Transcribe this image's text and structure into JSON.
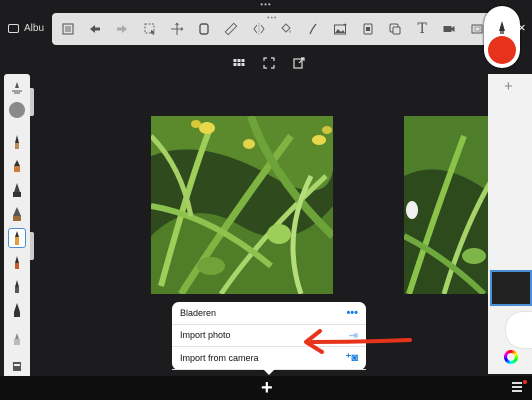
{
  "app": {
    "album_label_fragment": "Albu"
  },
  "toolbar": {
    "tools": [
      "list-icon",
      "undo-icon",
      "redo-icon",
      "select-icon",
      "transform-icon",
      "layer-icon",
      "ruler-icon",
      "symmetry-icon",
      "fill-icon",
      "stroke-icon",
      "image-icon",
      "stamp-icon",
      "perspective-icon",
      "text-icon",
      "video-icon",
      "crop-icon"
    ],
    "text_tool_glyph": "T"
  },
  "colors": {
    "accent_red": "#e8331c",
    "selection_blue": "#4a90d9",
    "menu_blue": "#1a7fe0"
  },
  "brushes": [
    "brush-1",
    "brush-2",
    "brush-3",
    "brush-4",
    "brush-5",
    "brush-6",
    "brush-7",
    "brush-8",
    "brush-9",
    "brush-10"
  ],
  "popover": {
    "items": [
      {
        "label": "Bladeren",
        "icon": "more-icon",
        "glyph": "•••"
      },
      {
        "label": "Import photo",
        "icon": "import-photo-icon",
        "glyph": "⇥"
      },
      {
        "label": "Import from camera",
        "icon": "camera-icon",
        "glyph": "⁺◙"
      }
    ]
  },
  "bottombar": {
    "add_glyph": "+"
  }
}
